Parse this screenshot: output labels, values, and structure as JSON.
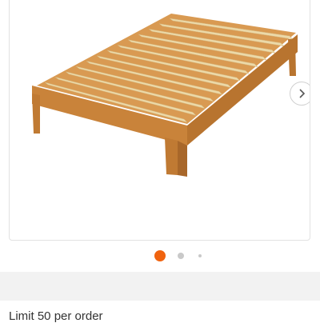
{
  "product": {
    "image_alt": "Wooden platform bed frame with slats",
    "image_subject": "bed-frame",
    "colors": {
      "wood": "#c9833a",
      "wood_dark": "#a8672a",
      "slat": "#ecd9a8"
    }
  },
  "carousel": {
    "next_icon": "chevron-right-icon",
    "dots": [
      {
        "state": "active",
        "color": "#f0630f"
      },
      {
        "state": "inactive",
        "color": "#c9c9c9"
      },
      {
        "state": "inactive",
        "color": "#c9c9c9"
      }
    ],
    "current_index": 1,
    "visible_dot_count": 3
  },
  "purchase": {
    "limit_text": "Limit 50 per order"
  }
}
